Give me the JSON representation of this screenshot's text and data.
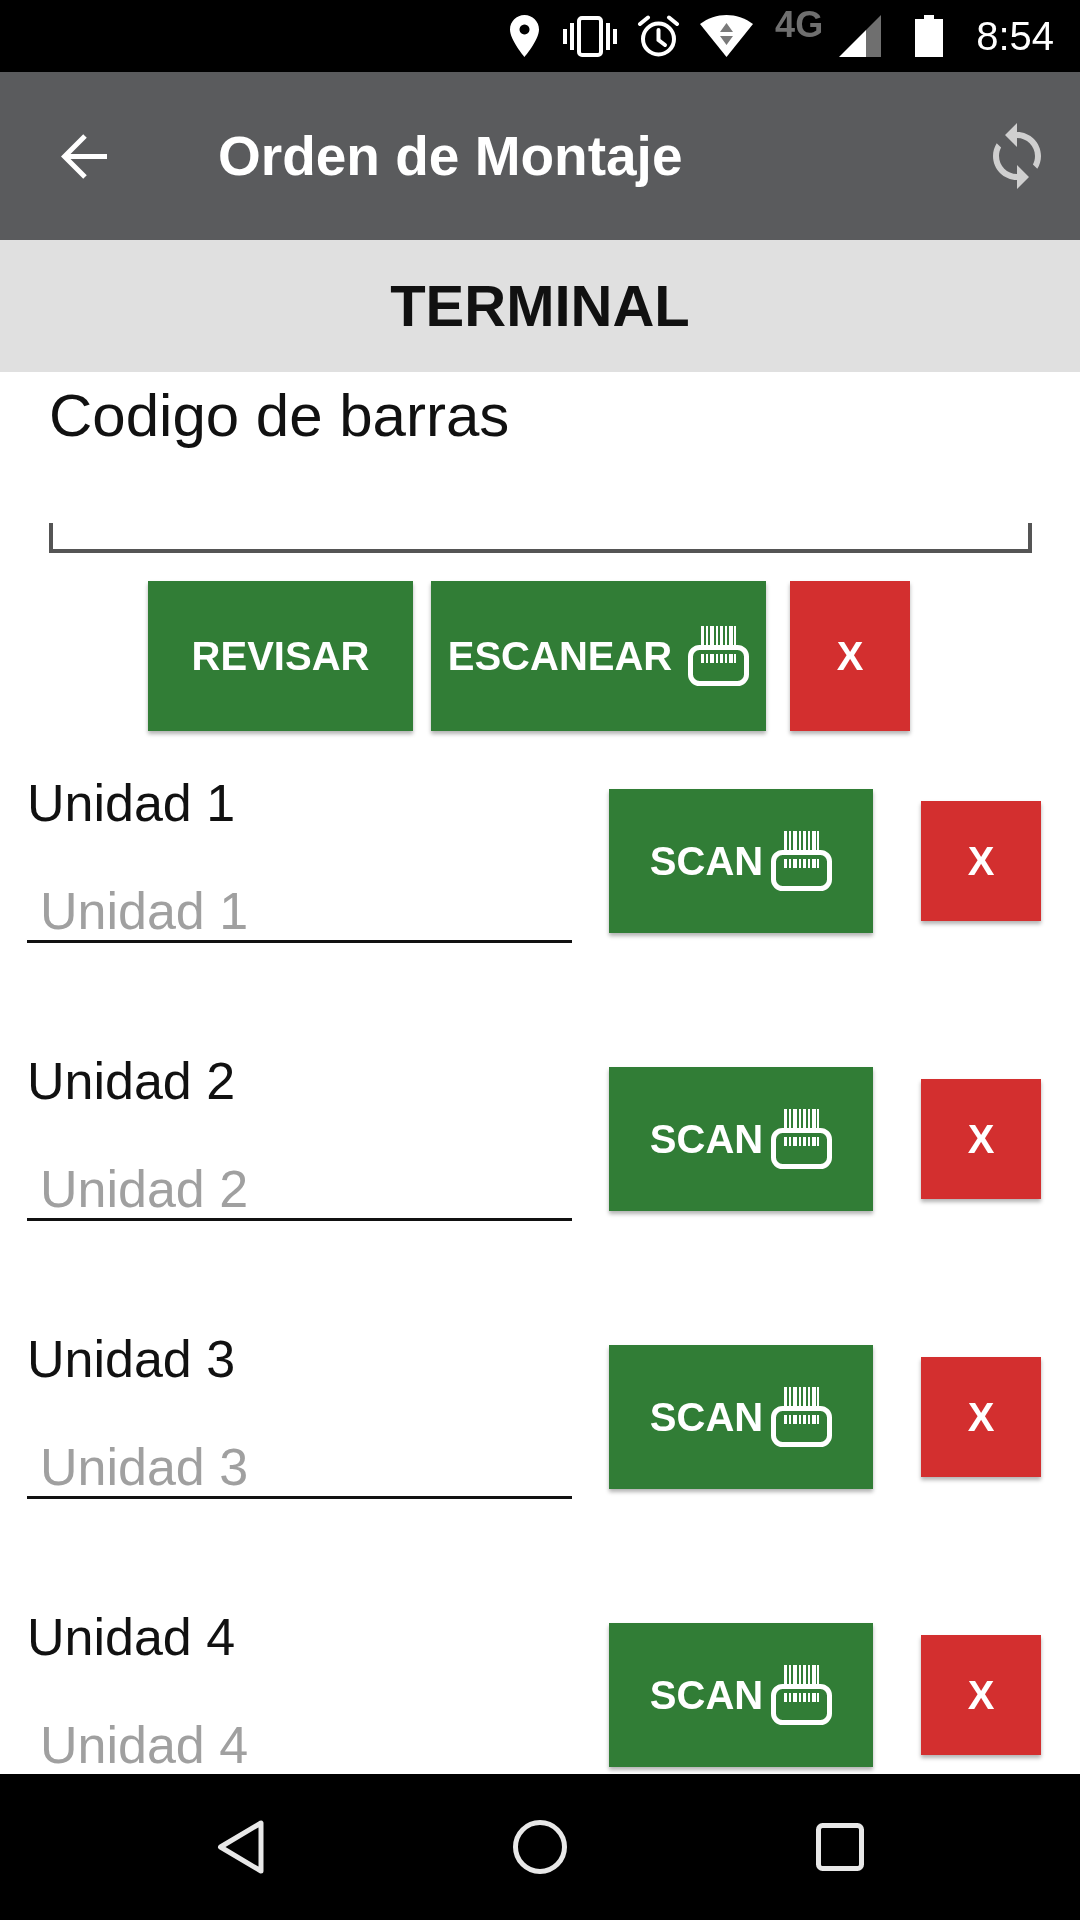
{
  "status_bar": {
    "network": "4G",
    "time": "8:54"
  },
  "app_bar": {
    "title": "Orden de Montaje"
  },
  "section": {
    "title": "TERMINAL"
  },
  "barcode": {
    "label": "Codigo de barras",
    "buttons": [
      {
        "label": "REVISAR",
        "kind": "confirm"
      },
      {
        "label": "ESCANEAR",
        "kind": "scan"
      },
      {
        "label": "X",
        "kind": "clear"
      }
    ]
  },
  "units": [
    {
      "label": "Unidad 1",
      "placeholder": "Unidad 1",
      "buttons": [
        {
          "label": "SCAN",
          "kind": "scan"
        },
        {
          "label": "X",
          "kind": "clear"
        }
      ]
    },
    {
      "label": "Unidad 2",
      "placeholder": "Unidad 2",
      "buttons": [
        {
          "label": "SCAN",
          "kind": "scan"
        },
        {
          "label": "X",
          "kind": "clear"
        }
      ]
    },
    {
      "label": "Unidad 3",
      "placeholder": "Unidad 3",
      "buttons": [
        {
          "label": "SCAN",
          "kind": "scan"
        },
        {
          "label": "X",
          "kind": "clear"
        }
      ]
    },
    {
      "label": "Unidad 4",
      "placeholder": "Unidad 4",
      "buttons": [
        {
          "label": "SCAN",
          "kind": "scan"
        },
        {
          "label": "X",
          "kind": "clear"
        }
      ]
    }
  ]
}
